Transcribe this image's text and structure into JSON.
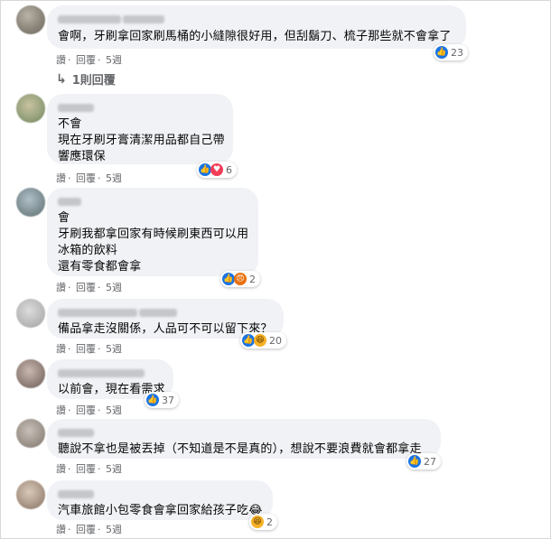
{
  "comments": [
    {
      "text": "會啊，牙刷拿回家刷馬桶的小縫隙很好用，但刮鬍刀、梳子那些就不會拿了",
      "reactions": {
        "count": "23",
        "icons": [
          "like-icon"
        ]
      },
      "actions": {
        "like": "讚",
        "reply": "回覆",
        "time": "5週"
      }
    },
    {
      "text": "不會\n現在牙刷牙膏清潔用品都自己帶\n響應環保",
      "reactions": {
        "count": "6",
        "icons": [
          "like-icon",
          "love-icon"
        ]
      },
      "actions": {
        "like": "讚",
        "reply": "回覆",
        "time": "5週"
      }
    },
    {
      "text": "會\n牙刷我都拿回家有時候刷東西可以用\n冰箱的飲料\n還有零食都會拿",
      "reactions": {
        "count": "2",
        "icons": [
          "like-icon",
          "angry-icon"
        ]
      },
      "actions": {
        "like": "讚",
        "reply": "回覆",
        "time": "5週"
      }
    },
    {
      "text": "備品拿走沒關係，人品可不可以留下來？",
      "reactions": {
        "count": "20",
        "icons": [
          "like-icon",
          "haha-icon"
        ]
      },
      "actions": {
        "like": "讚",
        "reply": "回覆",
        "time": "5週"
      }
    },
    {
      "text": "以前會，現在看需求",
      "reactions": {
        "count": "37",
        "icons": [
          "like-icon"
        ]
      },
      "actions": {
        "like": "讚",
        "reply": "回覆",
        "time": "5週"
      }
    },
    {
      "text": "聽說不拿也是被丟掉（不知道是不是真的），想說不要浪費就會都拿走",
      "reactions": {
        "count": "27",
        "icons": [
          "like-icon"
        ]
      },
      "actions": {
        "like": "讚",
        "reply": "回覆",
        "time": "5週"
      }
    },
    {
      "text": "汽車旅館小包零食會拿回家給孩子吃😂",
      "reactions": {
        "count": "2",
        "icons": [
          "haha-icon"
        ]
      },
      "actions": {
        "like": "讚",
        "reply": "回覆",
        "time": "5週"
      }
    }
  ],
  "replies_link": "1則回覆",
  "sep": "·",
  "colors": {
    "bubble": "#f0f2f5",
    "like": "#1b74e4",
    "secondary_text": "#65676b"
  }
}
